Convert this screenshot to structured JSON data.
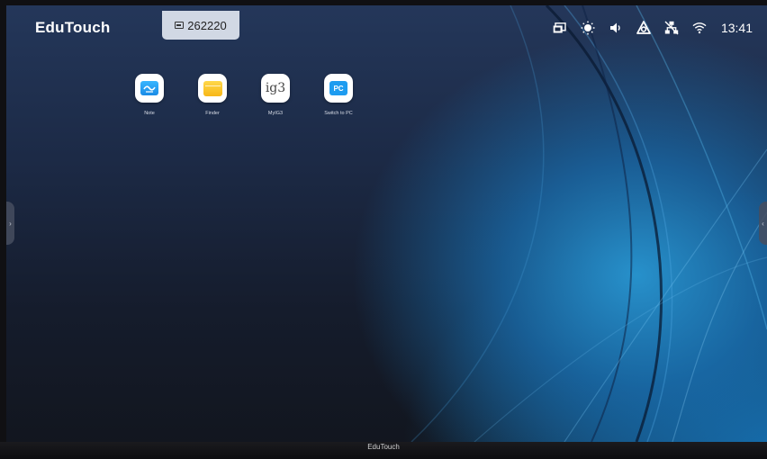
{
  "topbar": {
    "brand": "EduTouch",
    "room_code": "262220",
    "code_icon": "screen-code-icon",
    "status_icons": [
      "screen-share-icon",
      "brightness-icon",
      "volume-icon",
      "cloud-sync-icon",
      "network-icon",
      "wifi-icon"
    ],
    "clock": "13:41"
  },
  "apps": [
    {
      "label": "Note",
      "icon": "note-icon"
    },
    {
      "label": "Finder",
      "icon": "folder-icon"
    },
    {
      "label": "MyIG3",
      "icon": "ig3-icon",
      "glyph": "ig3"
    },
    {
      "label": "Switch to PC",
      "icon": "pc-icon",
      "glyph": "PC"
    }
  ],
  "side_handles": {
    "left": "›",
    "right": "‹"
  },
  "bezel": {
    "brand": "EduTouch"
  },
  "colors": {
    "accent": "#1e9cf0",
    "folder": "#f7b718",
    "background_top": "#24375a",
    "background_glow": "#2896d2"
  }
}
